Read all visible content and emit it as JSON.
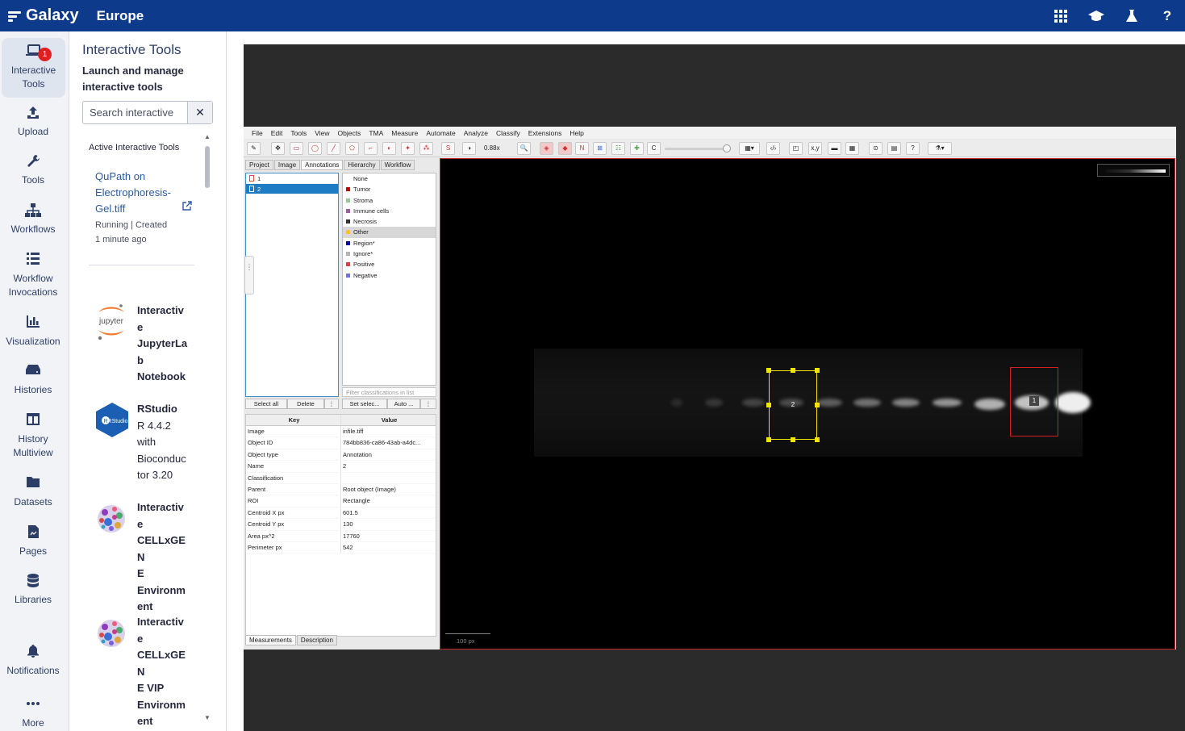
{
  "masthead": {
    "brand": "Galaxy",
    "subsite": "Europe"
  },
  "activity": [
    {
      "label": "Interactive Tools",
      "line1": "Interactive",
      "line2": "Tools",
      "badge": "1"
    },
    {
      "label": "Upload"
    },
    {
      "label": "Tools"
    },
    {
      "label": "Workflows"
    },
    {
      "line1": "Workflow",
      "line2": "Invocations"
    },
    {
      "label": "Visualization"
    },
    {
      "label": "Histories"
    },
    {
      "line1": "History",
      "line2": "Multiview"
    },
    {
      "label": "Datasets"
    },
    {
      "label": "Pages"
    },
    {
      "label": "Libraries"
    },
    {
      "label": "Notifications"
    },
    {
      "label": "More"
    }
  ],
  "panel": {
    "title": "Interactive Tools",
    "description": "Launch and manage interactive tools",
    "search_placeholder": "Search interactive",
    "active_heading": "Active Interactive Tools",
    "active_tool": {
      "name_line1": "QuPath on",
      "name_line2": "Electrophoresis-",
      "name_line3": "Gel.tiff",
      "status_line1": "Running | Created",
      "status_line2": "1 minute ago"
    },
    "tools": [
      {
        "lines": [
          "Interactiv",
          "e",
          "JupyterLa",
          "b",
          "Notebook"
        ],
        "logo_text": "jupyter"
      },
      {
        "lines": [
          "RStudio",
          "R 4.4.2",
          "with",
          "Bioconduc",
          "tor 3.20"
        ],
        "logo_text": "RStudio"
      },
      {
        "lines": [
          "Interactiv",
          "e",
          "CELLxGEN",
          "E",
          "Environm",
          "ent"
        ]
      },
      {
        "lines": [
          "Interactiv",
          "e",
          "CELLxGEN",
          "E VIP",
          "Environm",
          "ent"
        ]
      }
    ]
  },
  "qupath": {
    "menus": [
      "File",
      "Edit",
      "Tools",
      "View",
      "Objects",
      "TMA",
      "Measure",
      "Automate",
      "Analyze",
      "Classify",
      "Extensions",
      "Help"
    ],
    "zoom": "0.88x",
    "tabs": [
      "Project",
      "Image",
      "Annotations",
      "Hierarchy",
      "Workflow"
    ],
    "annotations": [
      "1",
      "2"
    ],
    "classes": [
      {
        "name": "None",
        "color": ""
      },
      {
        "name": "Tumor",
        "color": "#c80000"
      },
      {
        "name": "Stroma",
        "color": "#96c896"
      },
      {
        "name": "Immune cells",
        "color": "#a05aa0"
      },
      {
        "name": "Necrosis",
        "color": "#323232"
      },
      {
        "name": "Other",
        "color": "#ffc800"
      },
      {
        "name": "Region*",
        "color": "#0000b4"
      },
      {
        "name": "Ignore*",
        "color": "#b4b4b4"
      },
      {
        "name": "Positive",
        "color": "#e03c3c"
      },
      {
        "name": "Negative",
        "color": "#7070e0"
      }
    ],
    "filter_placeholder": "Filter classifications in list",
    "ann_buttons": [
      "Select all",
      "Delete",
      "⋮"
    ],
    "cls_buttons": [
      "Set selec...",
      "Auto ...",
      "⋮"
    ],
    "measure_header": {
      "key": "Key",
      "value": "Value"
    },
    "measurements": [
      [
        "Image",
        "infile.tiff"
      ],
      [
        "Object ID",
        "784bb836-ca86-43ab-a4dc..."
      ],
      [
        "Object type",
        "Annotation"
      ],
      [
        "Name",
        "2"
      ],
      [
        "Classification",
        ""
      ],
      [
        "Parent",
        "Root object (Image)"
      ],
      [
        "ROI",
        "Rectangle"
      ],
      [
        "Centroid X px",
        "601.5"
      ],
      [
        "Centroid Y px",
        "130"
      ],
      [
        "Area px^2",
        "17760"
      ],
      [
        "Perimeter px",
        "542"
      ]
    ],
    "bottom_tabs": [
      "Measurements",
      "Description"
    ],
    "scale_label": "100 px",
    "roi_labels": [
      "2",
      "1"
    ]
  }
}
